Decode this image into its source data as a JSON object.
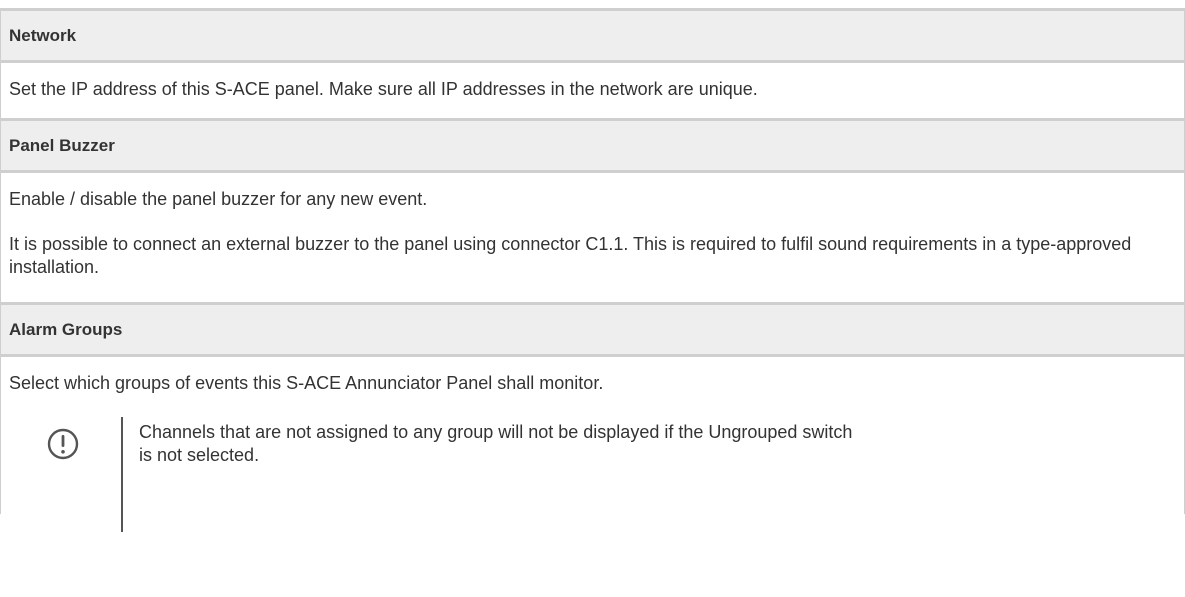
{
  "sections": {
    "network": {
      "heading": "Network",
      "text": "Set the IP address of this S-ACE panel. Make sure all IP addresses in the network are unique."
    },
    "buzzer": {
      "heading": "Panel Buzzer",
      "text1": "Enable / disable the panel buzzer for any new event.",
      "text2": "It is possible to connect an external buzzer to the panel using connector C1.1. This is required to fulfil sound requirements in a type-approved installation."
    },
    "alarm": {
      "heading": "Alarm Groups",
      "text": "Select which groups of events this S-ACE Annunciator Panel shall monitor.",
      "note": "Channels that are not assigned to any group will not be displayed if the Ungrouped switch is not selected.",
      "note_icon": "important-icon"
    }
  },
  "colors": {
    "header_bg": "#eeeeee",
    "border": "#cfcfcf",
    "text": "#333333"
  }
}
